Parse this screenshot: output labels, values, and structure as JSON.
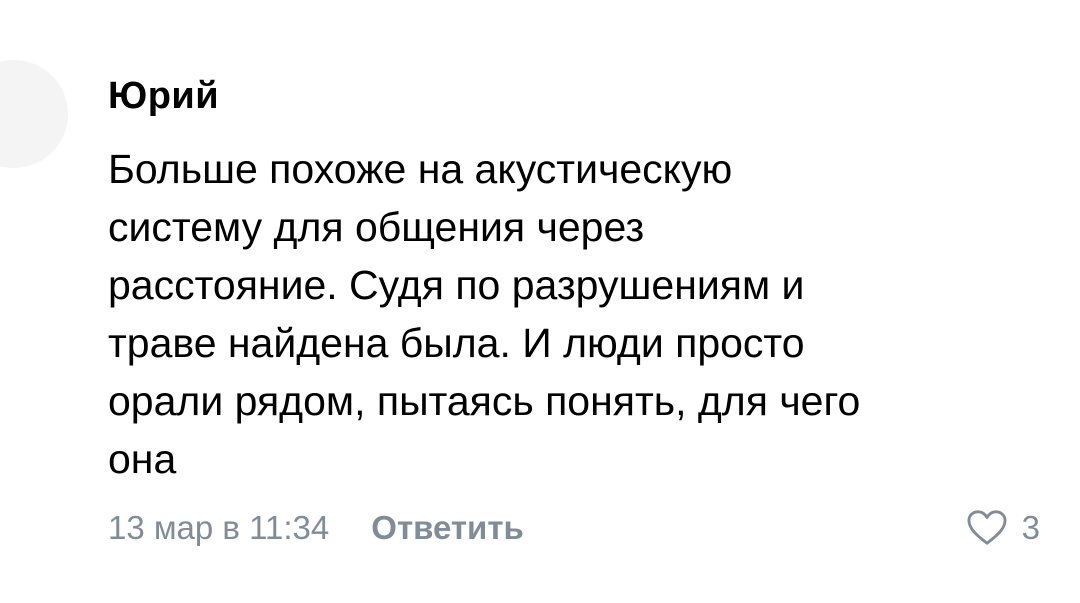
{
  "comment": {
    "author": "Юрий",
    "text": "Больше похоже на акустическую\nсистему для общения через\nрасстояние. Судя по разрушениям и\nтраве найдена была. И люди просто\nорали рядом, пытаясь понять, для чего\nона",
    "date": "13 мар в 11:34",
    "reply_label": "Ответить",
    "likes": "3",
    "like_icon": "heart-outline-icon",
    "colors": {
      "text": "#000000",
      "meta": "#818c99"
    }
  }
}
